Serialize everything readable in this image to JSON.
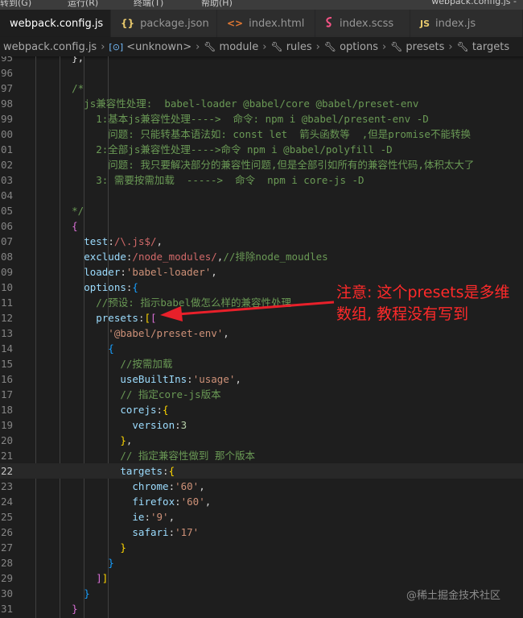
{
  "menubar": {
    "items": [
      "转到(G)",
      "运行(R)",
      "终端(T)",
      "帮助(H)"
    ],
    "window_title": "webpack.config.js - "
  },
  "tabs": [
    {
      "label": "webpack.config.js",
      "icon": "JS",
      "active": true,
      "close": "×"
    },
    {
      "label": "package.json",
      "icon": "{}",
      "active": false
    },
    {
      "label": "index.html",
      "icon": "<>",
      "active": false
    },
    {
      "label": "index.scss",
      "icon": "scss",
      "active": false
    },
    {
      "label": "index.js",
      "icon": "JS",
      "active": false
    }
  ],
  "breadcrumb": [
    {
      "label": "webpack.config.js",
      "icon": "js-file-icon"
    },
    {
      "label": "<unknown>",
      "icon": "object-icon"
    },
    {
      "label": "module",
      "icon": "wrench-icon"
    },
    {
      "label": "rules",
      "icon": "wrench-icon"
    },
    {
      "label": "options",
      "icon": "wrench-icon"
    },
    {
      "label": "presets",
      "icon": "wrench-icon"
    },
    {
      "label": "targets",
      "icon": "wrench-icon"
    }
  ],
  "breadcrumb_separator": "›",
  "editor": {
    "current_line": "22",
    "lines": [
      {
        "n": "95",
        "tokens": [
          [
            "p",
            "      },"
          ]
        ]
      },
      {
        "n": "96",
        "tokens": [
          [
            "p",
            ""
          ]
        ]
      },
      {
        "n": "97",
        "tokens": [
          [
            "c",
            "      /*"
          ]
        ]
      },
      {
        "n": "98",
        "tokens": [
          [
            "c",
            "        js兼容性处理:  babel-loader @babel/core @babel/preset-env"
          ]
        ]
      },
      {
        "n": "99",
        "tokens": [
          [
            "c",
            "          1:基本js兼容性处理---->  命令: npm i @babel/present-env -D"
          ]
        ]
      },
      {
        "n": "00",
        "tokens": [
          [
            "c",
            "            问题: 只能转基本语法如: const let  箭头函数等  ,但是promise不能转换"
          ]
        ]
      },
      {
        "n": "01",
        "tokens": [
          [
            "c",
            "          2:全部js兼容性处理---->命令 npm i @babel/polyfill -D"
          ]
        ]
      },
      {
        "n": "02",
        "tokens": [
          [
            "c",
            "            问题: 我只要解决部分的兼容性问题,但是全部引如所有的兼容性代码,体积太大了"
          ]
        ]
      },
      {
        "n": "03",
        "tokens": [
          [
            "c",
            "          3: 需要按需加载  ----->  命令  npm i core-js -D"
          ]
        ]
      },
      {
        "n": "04",
        "tokens": [
          [
            "p",
            ""
          ]
        ]
      },
      {
        "n": "05",
        "tokens": [
          [
            "c",
            "      */"
          ]
        ]
      },
      {
        "n": "06",
        "tokens": [
          [
            "p",
            "      "
          ],
          [
            "bp",
            "{"
          ]
        ]
      },
      {
        "n": "07",
        "tokens": [
          [
            "k",
            "        test"
          ],
          [
            "p",
            ":"
          ],
          [
            "r",
            "/\\.js$/"
          ],
          [
            "p",
            ","
          ]
        ]
      },
      {
        "n": "08",
        "tokens": [
          [
            "k",
            "        exclude"
          ],
          [
            "p",
            ":"
          ],
          [
            "r",
            "/node_modules/"
          ],
          [
            "p",
            ","
          ],
          [
            "c",
            "//排除node_moudles"
          ]
        ]
      },
      {
        "n": "09",
        "tokens": [
          [
            "k",
            "        loader"
          ],
          [
            "p",
            ":"
          ],
          [
            "s",
            "'babel-loader'"
          ],
          [
            "p",
            ","
          ]
        ]
      },
      {
        "n": "10",
        "tokens": [
          [
            "k",
            "        options"
          ],
          [
            "p",
            ":"
          ],
          [
            "bb",
            "{"
          ]
        ]
      },
      {
        "n": "11",
        "tokens": [
          [
            "c",
            "          //预设: 指示babel做怎么样的兼容性处理"
          ]
        ]
      },
      {
        "n": "12",
        "tokens": [
          [
            "k",
            "          presets"
          ],
          [
            "p",
            ":"
          ],
          [
            "bk",
            "["
          ],
          [
            "bp",
            "["
          ]
        ]
      },
      {
        "n": "13",
        "tokens": [
          [
            "s",
            "            '@babel/preset-env'"
          ],
          [
            "p",
            ","
          ]
        ]
      },
      {
        "n": "14",
        "tokens": [
          [
            "bb",
            "            {"
          ]
        ]
      },
      {
        "n": "15",
        "tokens": [
          [
            "c",
            "              //按需加载"
          ]
        ]
      },
      {
        "n": "16",
        "tokens": [
          [
            "k",
            "              useBuiltIns"
          ],
          [
            "p",
            ":"
          ],
          [
            "s",
            "'usage'"
          ],
          [
            "p",
            ","
          ]
        ]
      },
      {
        "n": "17",
        "tokens": [
          [
            "c",
            "              // 指定core-js版本"
          ]
        ]
      },
      {
        "n": "18",
        "tokens": [
          [
            "k",
            "              corejs"
          ],
          [
            "p",
            ":"
          ],
          [
            "bk",
            "{"
          ]
        ]
      },
      {
        "n": "19",
        "tokens": [
          [
            "k",
            "                version"
          ],
          [
            "p",
            ":"
          ],
          [
            "n",
            "3"
          ]
        ]
      },
      {
        "n": "20",
        "tokens": [
          [
            "bk",
            "              }"
          ],
          [
            "p",
            ","
          ]
        ]
      },
      {
        "n": "21",
        "tokens": [
          [
            "c",
            "              // 指定兼容性做到 那个版本"
          ]
        ]
      },
      {
        "n": "22",
        "tokens": [
          [
            "k",
            "              targets"
          ],
          [
            "p",
            ":"
          ],
          [
            "bk",
            "{"
          ]
        ]
      },
      {
        "n": "23",
        "tokens": [
          [
            "k",
            "                chrome"
          ],
          [
            "p",
            ":"
          ],
          [
            "s",
            "'60'"
          ],
          [
            "p",
            ","
          ]
        ]
      },
      {
        "n": "24",
        "tokens": [
          [
            "k",
            "                firefox"
          ],
          [
            "p",
            ":"
          ],
          [
            "s",
            "'60'"
          ],
          [
            "p",
            ","
          ]
        ]
      },
      {
        "n": "25",
        "tokens": [
          [
            "k",
            "                ie"
          ],
          [
            "p",
            ":"
          ],
          [
            "s",
            "'9'"
          ],
          [
            "p",
            ","
          ]
        ]
      },
      {
        "n": "26",
        "tokens": [
          [
            "k",
            "                safari"
          ],
          [
            "p",
            ":"
          ],
          [
            "s",
            "'17'"
          ]
        ]
      },
      {
        "n": "27",
        "tokens": [
          [
            "bk",
            "              }"
          ]
        ]
      },
      {
        "n": "28",
        "tokens": [
          [
            "bb",
            "            }"
          ]
        ]
      },
      {
        "n": "29",
        "tokens": [
          [
            "bp",
            "          ]"
          ],
          [
            "bk",
            "]"
          ]
        ]
      },
      {
        "n": "30",
        "tokens": [
          [
            "bb",
            "        }"
          ]
        ]
      },
      {
        "n": "31",
        "tokens": [
          [
            "bp",
            "      }"
          ]
        ]
      }
    ]
  },
  "annotation": "注意: 这个presets是多维数组, 教程没有写到",
  "watermark": "@稀土掘金技术社区",
  "colors": {
    "annotation": "#ff2a2a",
    "arrow": "#e8202a",
    "editor_bg": "#1e1e1e",
    "comment": "#6a9955",
    "property": "#9cdcfe",
    "string": "#ce9178",
    "regex": "#d16969"
  }
}
